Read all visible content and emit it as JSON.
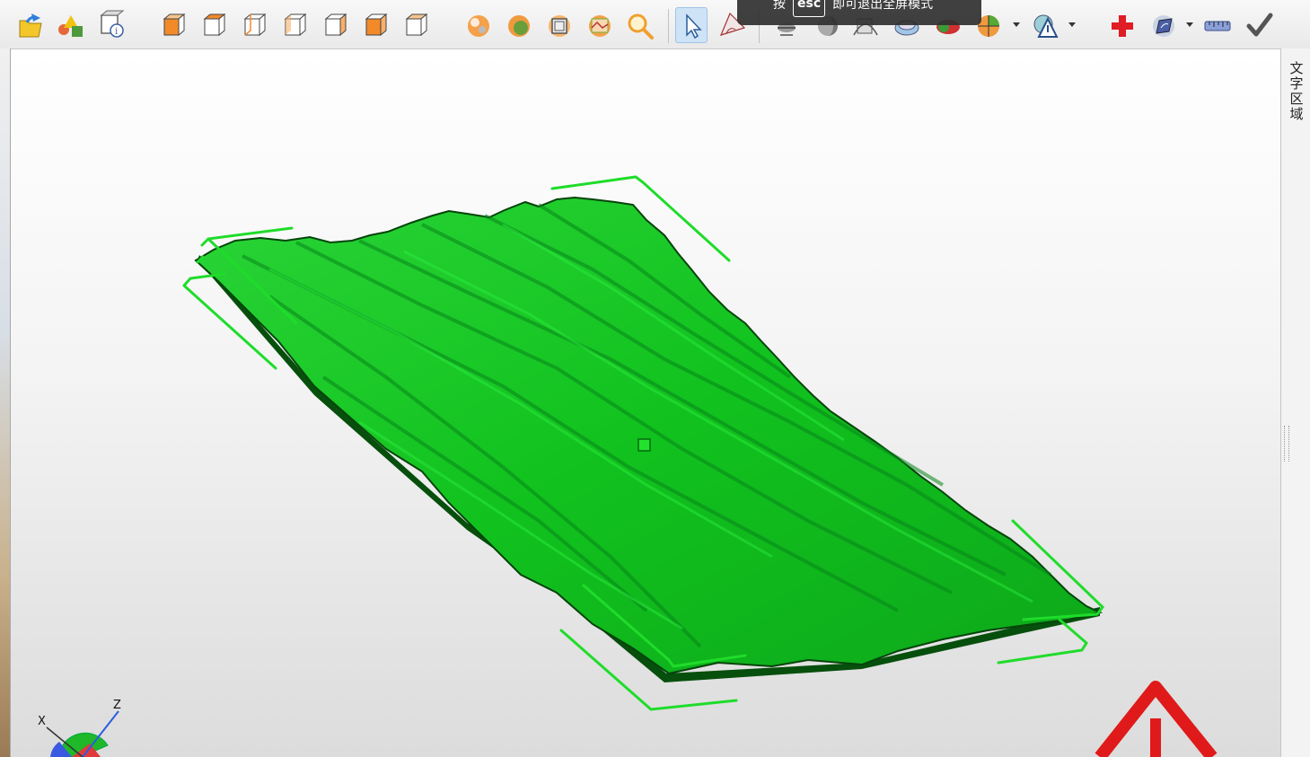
{
  "esc_banner": {
    "prefix": "按",
    "key": "esc",
    "suffix": "即可退出全屏模式"
  },
  "toolbar": {
    "buttons": [
      {
        "name": "open-file-button",
        "icon": "folder-arrow-icon"
      },
      {
        "name": "primitives-button",
        "icon": "shapes-icon"
      },
      {
        "name": "model-info-button",
        "icon": "info-icon"
      },
      {
        "name": "view-iso-button",
        "icon": "cube-iso-icon"
      },
      {
        "name": "view-front-button",
        "icon": "cube-front-icon"
      },
      {
        "name": "view-back-button",
        "icon": "cube-back-icon"
      },
      {
        "name": "view-left-button",
        "icon": "cube-left-icon"
      },
      {
        "name": "view-right-button",
        "icon": "cube-right-icon"
      },
      {
        "name": "view-top-button",
        "icon": "cube-top-icon"
      },
      {
        "name": "view-bottom-button",
        "icon": "cube-bottom-icon"
      },
      {
        "name": "render-points-button",
        "icon": "points-icon"
      },
      {
        "name": "render-smooth-button",
        "icon": "smooth-shading-icon"
      },
      {
        "name": "render-wire-button",
        "icon": "wireframe-icon"
      },
      {
        "name": "render-textured-button",
        "icon": "textured-icon"
      },
      {
        "name": "zoom-button",
        "icon": "magnifier-icon"
      },
      {
        "name": "select-button",
        "icon": "cursor-arrow-icon",
        "active": true
      },
      {
        "name": "measure-angle-button",
        "icon": "angle-measure-icon"
      },
      {
        "name": "cross-section-button",
        "icon": "section-icon"
      },
      {
        "name": "lighting-button",
        "icon": "lighting-icon"
      },
      {
        "name": "curvature-button",
        "icon": "curvature-icon"
      },
      {
        "name": "compare-button",
        "icon": "compare-icon"
      },
      {
        "name": "color-map-button",
        "icon": "color-map-icon"
      },
      {
        "name": "sphere-shading-button",
        "icon": "sphere-pie-icon"
      },
      {
        "name": "analysis-button",
        "icon": "analysis-warning-icon"
      },
      {
        "name": "add-button",
        "icon": "red-plus-icon"
      },
      {
        "name": "surface-tool-button",
        "icon": "surface-icon"
      },
      {
        "name": "ruler-button",
        "icon": "ruler-icon"
      },
      {
        "name": "confirm-button",
        "icon": "checkmark-icon"
      }
    ]
  },
  "right_panel": {
    "title": "文字区域"
  },
  "viewport": {
    "axes": {
      "x_label": "X",
      "z_label": "Z"
    },
    "model_color": "#11c21e",
    "bbox_color": "#1fdc2a",
    "warning_color": "#e01a1a"
  }
}
